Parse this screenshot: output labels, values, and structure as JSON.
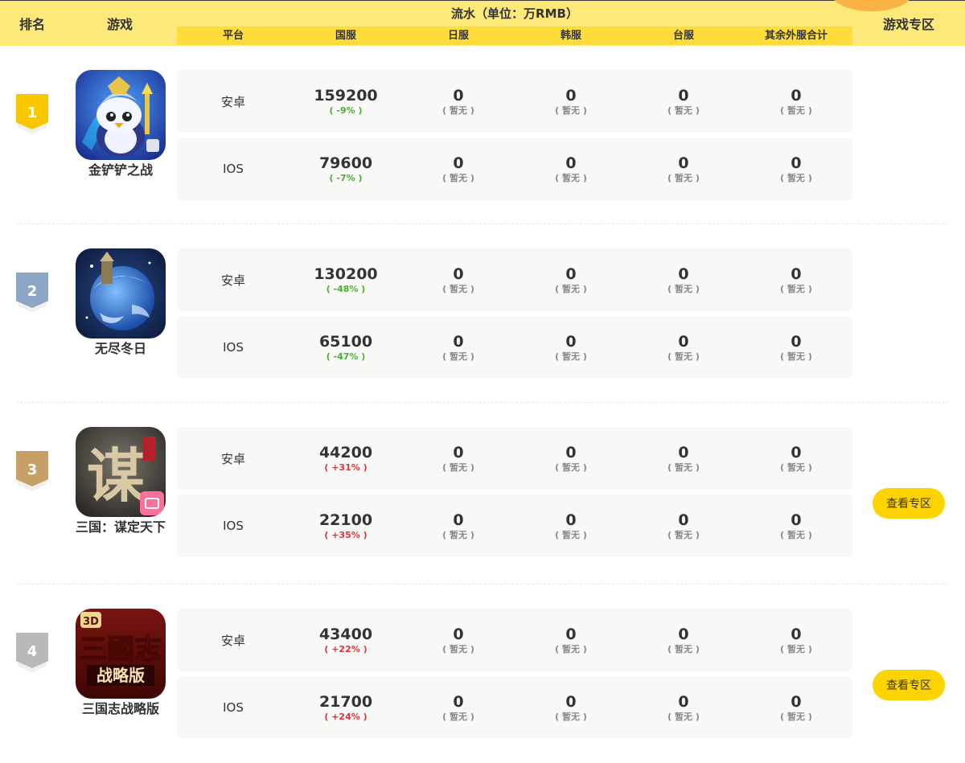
{
  "header": {
    "rank": "排名",
    "game": "游戏",
    "flow_title": "流水（单位：万RMB）",
    "zone": "游戏专区",
    "columns": [
      "平台",
      "国服",
      "日服",
      "韩服",
      "台服",
      "其余外服合计"
    ]
  },
  "rows": [
    {
      "rank": "1",
      "medal_color": "#f9c700",
      "name": "金铲铲之战",
      "platforms": [
        {
          "platform": "安卓",
          "cn": "159200",
          "cn_change": "( -9% )",
          "jp": "0",
          "kr": "0",
          "tw": "0",
          "other": "0"
        },
        {
          "platform": "IOS",
          "cn": "79600",
          "cn_change": "( -7% )",
          "jp": "0",
          "kr": "0",
          "tw": "0",
          "other": "0"
        }
      ]
    },
    {
      "rank": "2",
      "medal_color": "#8da6c6",
      "name": "无尽冬日",
      "platforms": [
        {
          "platform": "安卓",
          "cn": "130200",
          "cn_change": "( -48% )",
          "jp": "0",
          "kr": "0",
          "tw": "0",
          "other": "0"
        },
        {
          "platform": "IOS",
          "cn": "65100",
          "cn_change": "( -47% )",
          "jp": "0",
          "kr": "0",
          "tw": "0",
          "other": "0"
        }
      ]
    },
    {
      "rank": "3",
      "medal_color": "#c7a067",
      "name": "三国：谋定天下",
      "platforms": [
        {
          "platform": "安卓",
          "cn": "44200",
          "cn_change": "( +31% )",
          "jp": "0",
          "kr": "0",
          "tw": "0",
          "other": "0"
        },
        {
          "platform": "IOS",
          "cn": "22100",
          "cn_change": "( +35% )",
          "jp": "0",
          "kr": "0",
          "tw": "0",
          "other": "0"
        }
      ],
      "zone_button": "查看专区"
    },
    {
      "rank": "4",
      "medal_color": "#b9b9b9",
      "name": "三国志战略版",
      "platforms": [
        {
          "platform": "安卓",
          "cn": "43400",
          "cn_change": "( +22% )",
          "jp": "0",
          "kr": "0",
          "tw": "0",
          "other": "0"
        },
        {
          "platform": "IOS",
          "cn": "21700",
          "cn_change": "( +24% )",
          "jp": "0",
          "kr": "0",
          "tw": "0",
          "other": "0"
        }
      ],
      "zone_button": "查看专区"
    }
  ],
  "na_label": "( 暂无 )",
  "icons": [
    "penguin-knight-icon",
    "frozen-planet-icon",
    "mou-calligraphy-icon",
    "sanguozhi-logo-icon"
  ],
  "colors": {
    "header_bg": "#fde97a",
    "subheader_bg": "#fedd3a",
    "row_bg": "#f8f8f7",
    "decrease": "#45b12e",
    "increase": "#e2323b",
    "button": "#fdd300"
  }
}
